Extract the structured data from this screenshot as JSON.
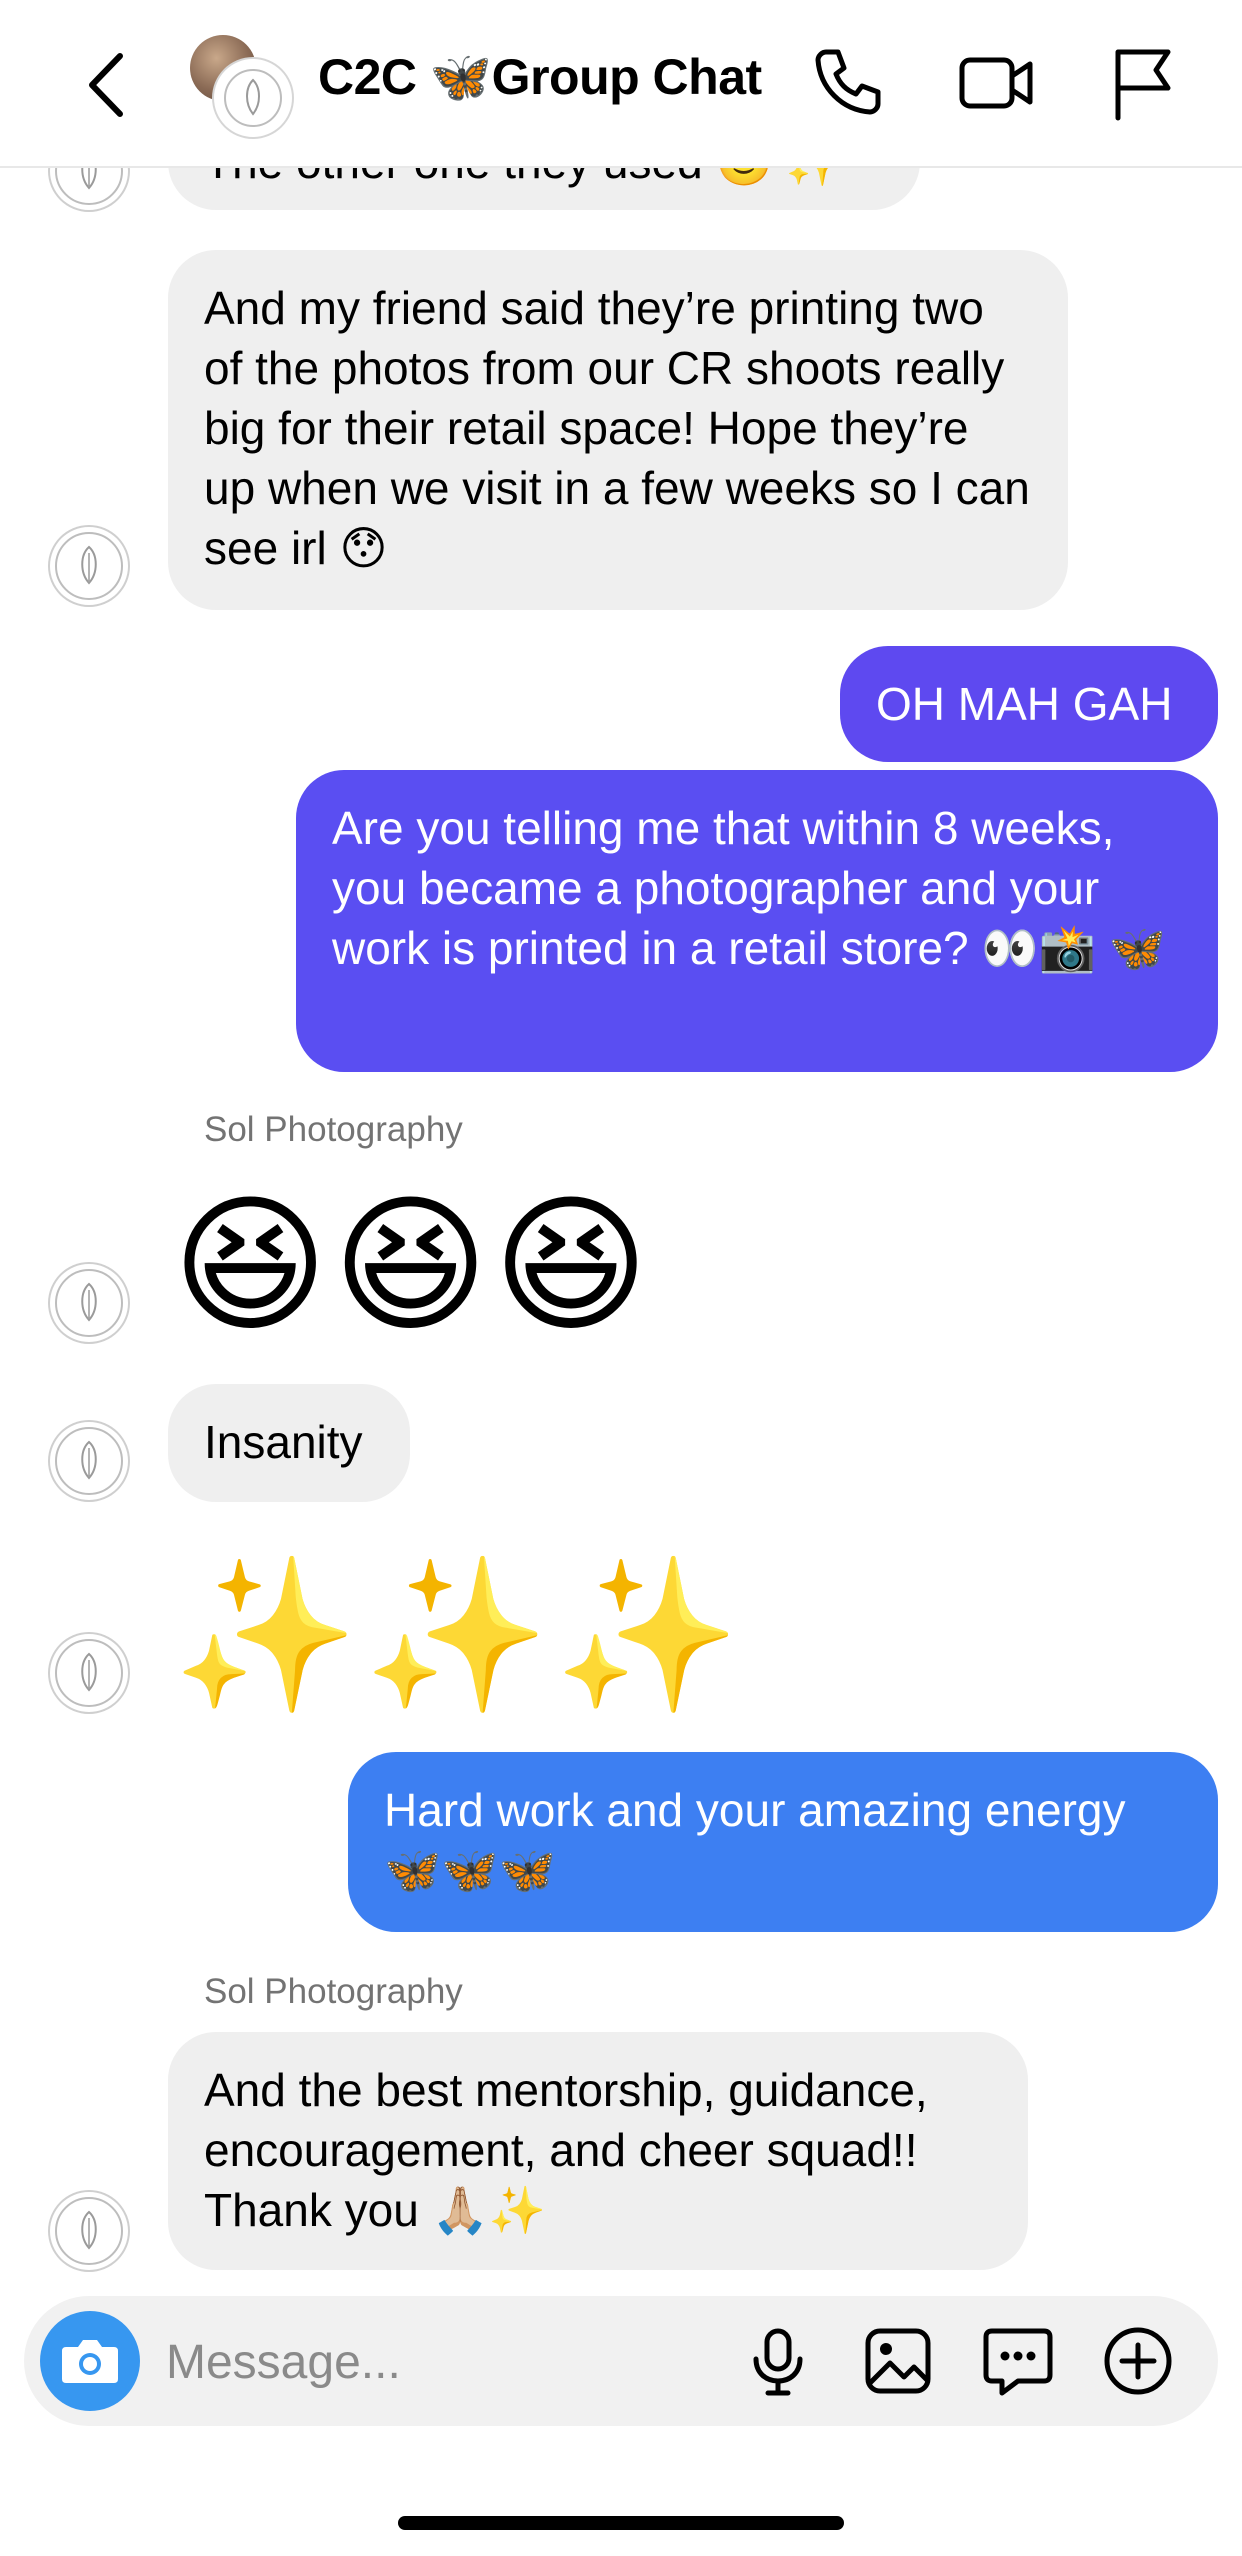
{
  "header": {
    "title": "C2C 🦋Group Chat",
    "icons": [
      "back-chevron-icon",
      "phone-icon",
      "video-camera-icon",
      "flag-icon"
    ]
  },
  "messages": [
    {
      "from": "Sol Photography",
      "text": "The other one they used 🙂 ✨"
    },
    {
      "from": "Sol Photography",
      "text": "And my friend said they’re printing two of the photos from our CR shoots really big for their retail space! Hope they’re up when we visit in a few weeks so I can see irl 😯"
    },
    {
      "from": "me",
      "text": "OH MAH GAH",
      "color": "#5e49f0"
    },
    {
      "from": "me",
      "text": "Are you telling me that within 8 weeks, you became a photographer and your work is printed in a retail store? 👀📸 🦋",
      "color": "#5a4ef2"
    },
    {
      "from": "Sol Photography",
      "sender_label": "Sol Photography",
      "text": "😆😆😆"
    },
    {
      "from": "Sol Photography",
      "text": "Insanity"
    },
    {
      "from": "Sol Photography",
      "text": "✨✨✨"
    },
    {
      "from": "me",
      "text": "Hard work and your amazing energy 🦋🦋🦋",
      "color": "#3d7ff2"
    },
    {
      "from": "Sol Photography",
      "sender_label": "Sol Photography",
      "text": "And the best mentorship, guidance, encouragement, and cheer squad!! Thank you 🙏🏼✨"
    }
  ],
  "composer": {
    "placeholder": "Message...",
    "icons": [
      "camera-icon",
      "microphone-icon",
      "gallery-icon",
      "sticker-chat-icon",
      "plus-icon"
    ],
    "camera_color": "#3797f0"
  },
  "avatar_label": "SOL PHOTOGRAPHY"
}
